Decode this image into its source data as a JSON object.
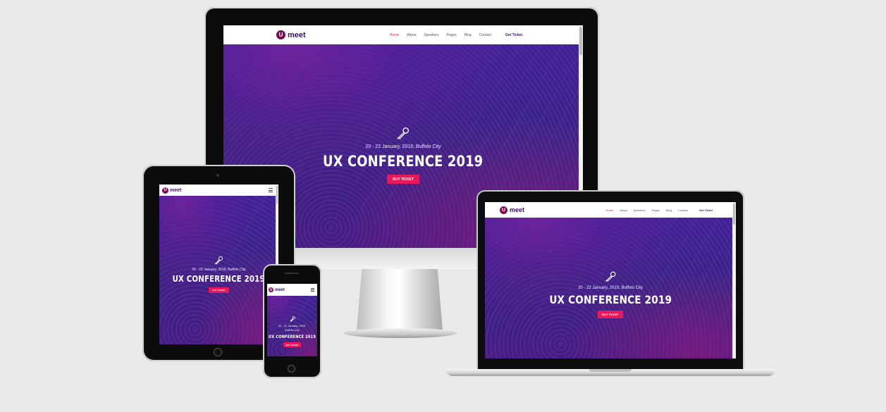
{
  "site": {
    "logo_letter": "U",
    "logo_text": "meet",
    "nav": [
      "Home",
      "About",
      "Speakers",
      "Pages",
      "Blog",
      "Contact"
    ],
    "nav_cta": "Get Ticket",
    "date_line": "20 - 22 January, 2019, Buffolo City",
    "title": "UX CONFERENCE 2019",
    "button": "BUY TICKET"
  },
  "colors": {
    "accent": "#e8185b",
    "logo": "#7a0a52",
    "hero_base": "#30208a",
    "background": "#e9e9ea"
  },
  "icons": {
    "hero": "microphone-icon",
    "mobile_menu": "hamburger-icon"
  }
}
